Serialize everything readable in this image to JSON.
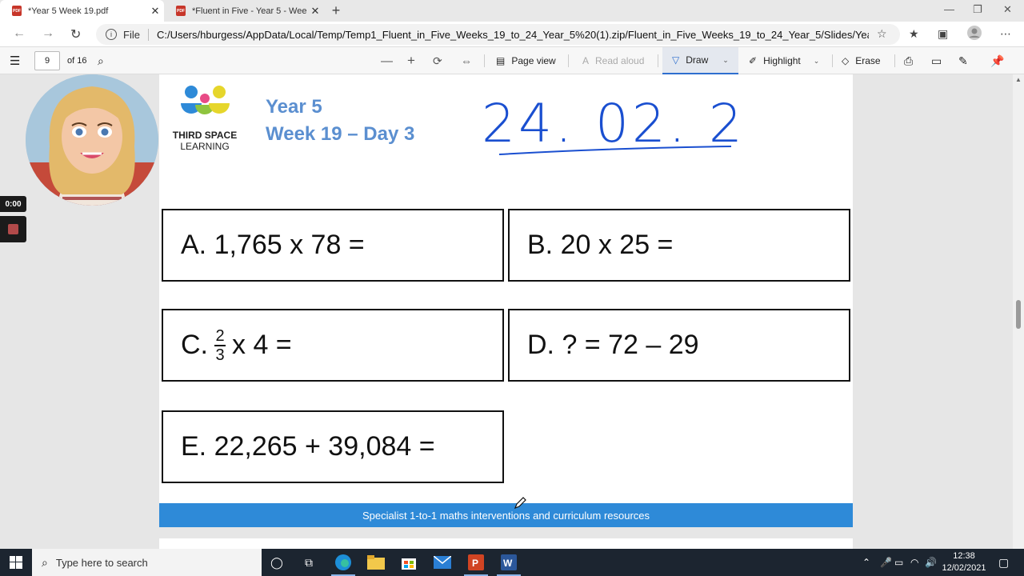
{
  "browser": {
    "tabs": [
      {
        "title": "*Year 5 Week 19.pdf",
        "active": true
      },
      {
        "title": "*Fluent in Five - Year 5 - Week 19",
        "active": false
      }
    ],
    "address": {
      "file_label": "File",
      "url": "C:/Users/hburgess/AppData/Local/Temp/Temp1_Fluent_in_Five_Weeks_19_to_24_Year_5%20(1).zip/Fluent_in_Five_Weeks_19_to_24_Year_5/Slides/Year..."
    }
  },
  "pdf_toolbar": {
    "page_number": "9",
    "page_total": "of 16",
    "page_view_label": "Page view",
    "read_aloud_label": "Read aloud",
    "draw_label": "Draw",
    "highlight_label": "Highlight",
    "erase_label": "Erase"
  },
  "recording": {
    "time": "0:00"
  },
  "slide": {
    "brand_line1": "THIRD SPACE",
    "brand_line2": "LEARNING",
    "title_year": "Year 5",
    "title_week": "Week 19 – Day 3",
    "handwritten_date": "24. 02. 21",
    "questions": {
      "a": "A. 1,765 x 78 =",
      "b": "B. 20 x 25 =",
      "c_prefix": "C.",
      "c_num": "2",
      "c_den": "3",
      "c_suffix": "x 4 =",
      "d": "D. ? = 72 – 29",
      "e": "E. 22,265 + 39,084 ="
    },
    "footer": "Specialist 1-to-1 maths interventions and curriculum resources"
  },
  "taskbar": {
    "search_placeholder": "Type here to search",
    "time": "12:38",
    "date": "12/02/2021"
  },
  "colors": {
    "title_blue": "#5b8fd0",
    "footer_blue": "#2e8ad8",
    "ink_blue": "#1a4fd0"
  }
}
